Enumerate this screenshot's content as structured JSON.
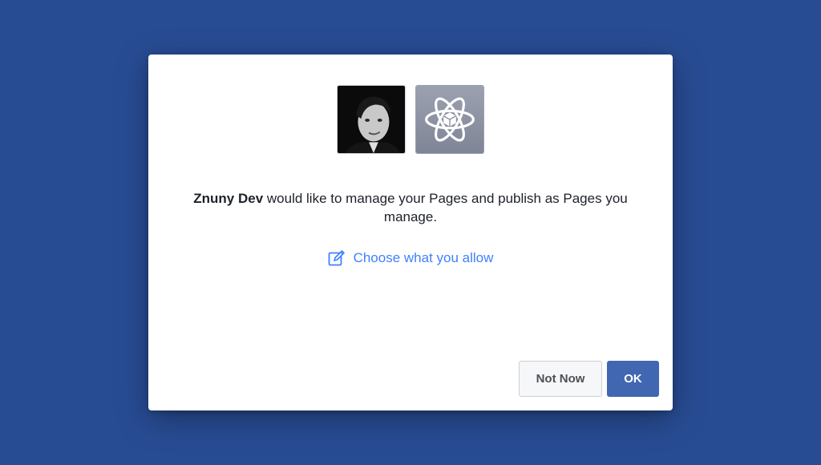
{
  "dialog": {
    "app_name": "Znuny Dev",
    "message_rest": " would like to manage your Pages and publish as Pages you manage.",
    "choose_link": "Choose what you allow",
    "buttons": {
      "not_now": "Not Now",
      "ok": "OK"
    }
  },
  "icons": {
    "user_avatar": "user-profile-photo",
    "app_icon": "atom-cube-icon",
    "edit_icon": "pencil-square-icon"
  },
  "colors": {
    "background": "#284c94",
    "link": "#4080ff",
    "primary_button": "#4267b2",
    "app_icon_bg": "#8a90a0"
  }
}
